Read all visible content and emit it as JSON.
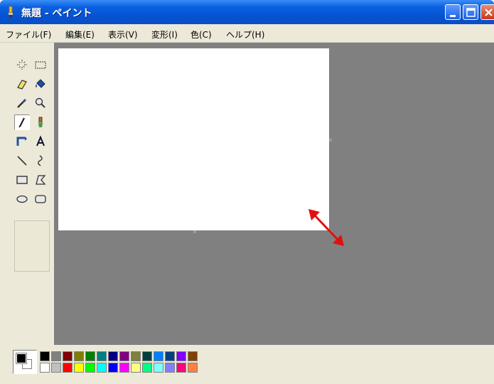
{
  "window": {
    "title": "無題 - ペイント",
    "minimize_label": "Minimize",
    "maximize_label": "Maximize",
    "close_label": "Close"
  },
  "menu": [
    {
      "label": "ファイル(F)"
    },
    {
      "label": "編集(E)"
    },
    {
      "label": "表示(V)"
    },
    {
      "label": "変形(I)"
    },
    {
      "label": "色(C)"
    },
    {
      "label": "ヘルプ(H)"
    }
  ],
  "tools": [
    {
      "name": "free-form-select-icon"
    },
    {
      "name": "rectangle-select-icon"
    },
    {
      "name": "eraser-icon"
    },
    {
      "name": "fill-bucket-icon"
    },
    {
      "name": "color-picker-icon"
    },
    {
      "name": "magnifier-icon"
    },
    {
      "name": "pencil-icon",
      "selected": true
    },
    {
      "name": "brush-icon"
    },
    {
      "name": "airbrush-icon"
    },
    {
      "name": "text-icon"
    },
    {
      "name": "line-icon"
    },
    {
      "name": "curve-icon"
    },
    {
      "name": "rectangle-icon"
    },
    {
      "name": "polygon-icon"
    },
    {
      "name": "ellipse-icon"
    },
    {
      "name": "rounded-rectangle-icon"
    }
  ],
  "colors": {
    "titlebar": "#0552d2",
    "menubar": "#ece9d8",
    "workarea": "#808080",
    "canvas": "#ffffff",
    "resize_arrow": "#e01010",
    "foreground": "#000000",
    "background": "#ffffff"
  },
  "palette": {
    "top_row": [
      "#000000",
      "#808080",
      "#800000",
      "#808000",
      "#008000",
      "#008080",
      "#000080",
      "#800080",
      "#808040",
      "#004040",
      "#0080ff",
      "#004080",
      "#8000ff",
      "#804000"
    ],
    "bottom_row": [
      "#ffffff",
      "#c0c0c0",
      "#ff0000",
      "#ffff00",
      "#00ff00",
      "#00ffff",
      "#0000ff",
      "#ff00ff",
      "#ffff80",
      "#00ff80",
      "#80ffff",
      "#8080ff",
      "#ff0080",
      "#ff8040"
    ]
  }
}
